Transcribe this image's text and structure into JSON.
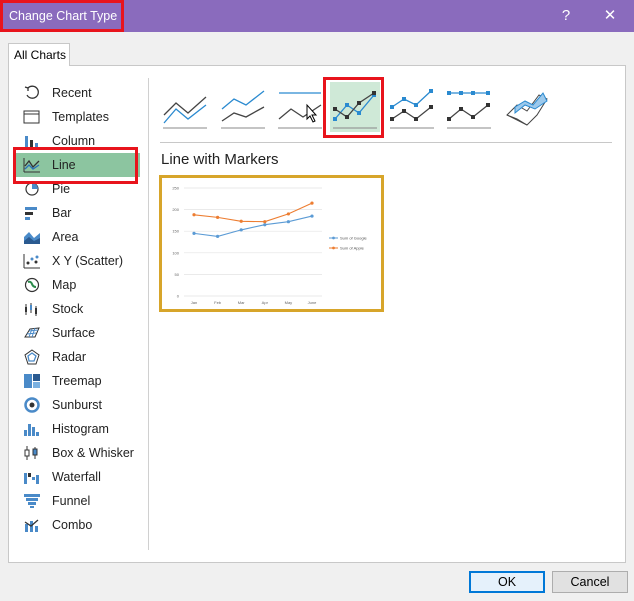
{
  "window": {
    "title": "Change Chart Type",
    "help_label": "?",
    "close_label": "✕"
  },
  "tabs": [
    {
      "label": "All Charts"
    }
  ],
  "sidebar": {
    "items": [
      {
        "label": "Recent",
        "icon": "recent-icon"
      },
      {
        "label": "Templates",
        "icon": "templates-icon"
      },
      {
        "label": "Column",
        "icon": "column-chart-icon"
      },
      {
        "label": "Line",
        "icon": "line-chart-icon",
        "selected": true
      },
      {
        "label": "Pie",
        "icon": "pie-chart-icon"
      },
      {
        "label": "Bar",
        "icon": "bar-chart-icon"
      },
      {
        "label": "Area",
        "icon": "area-chart-icon"
      },
      {
        "label": "X Y (Scatter)",
        "icon": "scatter-chart-icon"
      },
      {
        "label": "Map",
        "icon": "map-chart-icon"
      },
      {
        "label": "Stock",
        "icon": "stock-chart-icon"
      },
      {
        "label": "Surface",
        "icon": "surface-chart-icon"
      },
      {
        "label": "Radar",
        "icon": "radar-chart-icon"
      },
      {
        "label": "Treemap",
        "icon": "treemap-chart-icon"
      },
      {
        "label": "Sunburst",
        "icon": "sunburst-chart-icon"
      },
      {
        "label": "Histogram",
        "icon": "histogram-chart-icon"
      },
      {
        "label": "Box & Whisker",
        "icon": "box-whisker-chart-icon"
      },
      {
        "label": "Waterfall",
        "icon": "waterfall-chart-icon"
      },
      {
        "label": "Funnel",
        "icon": "funnel-chart-icon"
      },
      {
        "label": "Combo",
        "icon": "combo-chart-icon"
      }
    ]
  },
  "subtypes": {
    "selected_index": 3,
    "items": [
      "line-icon",
      "stacked-line-icon",
      "100-stacked-line-icon",
      "line-with-markers-icon",
      "stacked-line-with-markers-icon",
      "100-stacked-line-with-markers-icon",
      "3d-line-icon"
    ]
  },
  "preview": {
    "title": "Line with Markers"
  },
  "colors": {
    "titlebar": "#8a6bbd",
    "selected": "#8cc5a0",
    "series_google": "#5b9bd5",
    "series_apple": "#ed7d31"
  },
  "chart_data": {
    "type": "line",
    "categories": [
      "Jan",
      "Feb",
      "Mar",
      "Apr",
      "May",
      "June"
    ],
    "series": [
      {
        "name": "Sum of Google",
        "values": [
          145,
          138,
          153,
          165,
          172,
          185
        ]
      },
      {
        "name": "Sum of Apple",
        "values": [
          188,
          182,
          173,
          172,
          190,
          215
        ]
      }
    ],
    "yticks": [
      "250",
      "200",
      "150",
      "100",
      "50",
      "0"
    ],
    "ylim": [
      0,
      250
    ],
    "grid": true,
    "legend": "right"
  },
  "buttons": {
    "ok": "OK",
    "cancel": "Cancel"
  }
}
